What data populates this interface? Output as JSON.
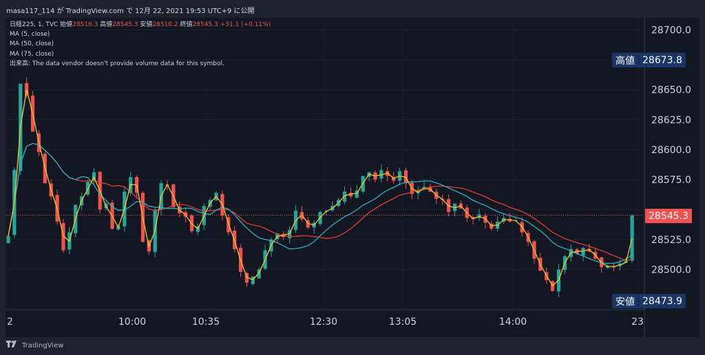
{
  "header": {
    "text": "masa117_114 が TradingView.com で 12月 22, 2021 19:53 UTC+9 に公開"
  },
  "legend": {
    "symbol": "日経225, 1, TVC",
    "open_label": "始値",
    "open": "28516.3",
    "high_label": "高値",
    "high": "28545.3",
    "low_label": "安値",
    "low": "28510.2",
    "close_label": "終値",
    "close": "28545.3",
    "change": "+31.1 (+0.11%)",
    "ma5": "MA (5, close)",
    "ma50": "MA (50, close)",
    "ma75": "MA (75, close)",
    "volume_label": "出来高:",
    "volume_note": "The data vendor doesn't provide volume data for this symbol."
  },
  "price_tags": {
    "high_label": "高値",
    "high_value": "28673.8",
    "low_label": "安値",
    "low_value": "28473.9",
    "last_value": "28545.3"
  },
  "footer": {
    "brand": "TradingView"
  },
  "colors": {
    "background": "#131722",
    "up": "#26a69a",
    "down": "#ef5350",
    "ma5": "#f7c325",
    "ma50": "#2ab3c5",
    "ma75": "#e23a3a",
    "tag_blue": "#1a3566",
    "tag_last": "#ef5350"
  },
  "chart_data": {
    "type": "candlestick",
    "symbol": "日経225, 1, TVC",
    "timeframe": "1",
    "x_ticks": [
      "2",
      "10:00",
      "10:35",
      "12:30",
      "13:05",
      "14:00",
      "23"
    ],
    "y_ticks": [
      28500,
      28525,
      28550,
      28575,
      28600,
      28625,
      28650,
      28675,
      28700
    ],
    "y_tick_labels": [
      "28500.0",
      "28525.0",
      "",
      "28575.0",
      "28600.0",
      "28625.0",
      "28650.0",
      "",
      "28700.0"
    ],
    "ylim": [
      28467,
      28710
    ],
    "series_close": [
      28528,
      28583,
      28655,
      28645,
      28615,
      28598,
      28572,
      28561,
      28540,
      28516,
      28531,
      28554,
      28561,
      28573,
      28581,
      28550,
      28555,
      28534,
      28536,
      28565,
      28577,
      28564,
      28523,
      28515,
      28550,
      28572,
      28570,
      28552,
      28547,
      28544,
      28532,
      28536,
      28553,
      28558,
      28564,
      28545,
      28531,
      28517,
      28498,
      28489,
      28494,
      28500,
      28516,
      28525,
      28530,
      28527,
      28533,
      28549,
      28542,
      28535,
      28539,
      28548,
      28549,
      28553,
      28558,
      28565,
      28561,
      28566,
      28578,
      28581,
      28575,
      28583,
      28578,
      28574,
      28582,
      28572,
      28563,
      28566,
      28569,
      28565,
      28559,
      28558,
      28548,
      28555,
      28551,
      28543,
      28542,
      28546,
      28539,
      28534,
      28540,
      28543,
      28540,
      28541,
      28531,
      28523,
      28509,
      28499,
      28491,
      28482,
      28500,
      28511,
      28517,
      28513,
      28518,
      28515,
      28509,
      28502,
      28503,
      28502,
      28505,
      28507,
      28545
    ],
    "annotations": {
      "high": "28673.8",
      "low": "28473.9",
      "last": "28545.3"
    }
  }
}
